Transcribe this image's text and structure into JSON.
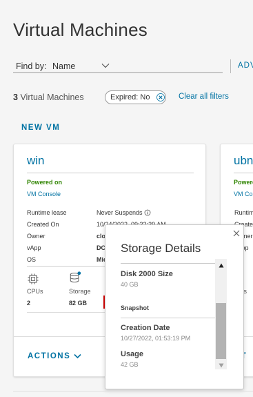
{
  "page": {
    "title": "Virtual Machines"
  },
  "filter": {
    "find_by_label": "Find by:",
    "find_by_value": "Name",
    "advanced_label": "ADV"
  },
  "summary": {
    "count": "3",
    "count_label": "Virtual Machines",
    "chip_label": "Expired: No",
    "clear_label": "Clear all filters"
  },
  "new_vm_label": "NEW VM",
  "cards": [
    {
      "name": "win",
      "power": "Powered on",
      "console": "VM Console",
      "rows": [
        {
          "key": "Runtime lease",
          "value": "Never Suspends"
        },
        {
          "key": "Created On",
          "value": "10/24/2022, 09:32:39 AM"
        },
        {
          "key": "Owner",
          "value": "clo"
        },
        {
          "key": "vApp",
          "value": "DC"
        },
        {
          "key": "OS",
          "value": "Mic"
        }
      ],
      "stats": {
        "cpus_label": "CPUs",
        "cpus_value": "2",
        "storage_label": "Storage",
        "storage_value": "82 GB"
      },
      "actions_label": "ACTIONS"
    },
    {
      "name": "ubn",
      "power": "Powered",
      "console": "VM Cons",
      "rows": [
        "Runtim",
        "Create",
        "Owner",
        "vApp",
        "OS"
      ],
      "cpus_partial": "Us",
      "actions_partial": "CT"
    }
  ],
  "storage_popover": {
    "title": "Storage Details",
    "disk_label": "Disk 2000 Size",
    "disk_value": "40 GB",
    "snapshot_heading": "Snapshot",
    "creation_label": "Creation Date",
    "creation_value": "10/27/2022, 01:53:19 PM",
    "usage_label": "Usage",
    "usage_value": "42 GB"
  },
  "colors": {
    "accent": "#0072a3",
    "powered_on": "#2f8400",
    "highlight": "#d40000",
    "notification_dot": "#0072a3"
  },
  "icons": {
    "find_by_dropdown": "chevron-down-icon",
    "chip_remove": "close-circle-icon",
    "runtime_info": "info-circle-icon",
    "cpu": "cpu-chip-icon",
    "storage": "database-icon",
    "storage_info": "info-circle-icon",
    "actions_dropdown": "chevron-down-icon",
    "popover_close": "close-icon",
    "scroll_up": "triangle-up-icon",
    "scroll_down": "triangle-down-icon"
  }
}
